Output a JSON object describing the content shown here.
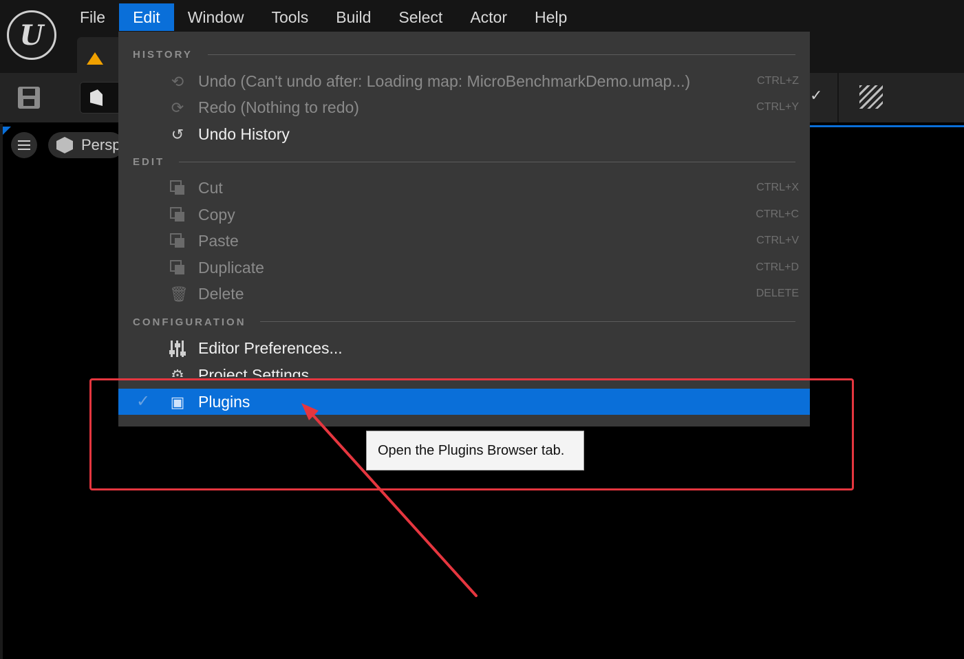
{
  "menubar": {
    "logo_letter": "U",
    "items": [
      {
        "label": "File"
      },
      {
        "label": "Edit",
        "active": true
      },
      {
        "label": "Window"
      },
      {
        "label": "Tools"
      },
      {
        "label": "Build"
      },
      {
        "label": "Select"
      },
      {
        "label": "Actor"
      },
      {
        "label": "Help"
      }
    ]
  },
  "viewport": {
    "perspective_label": "Persp"
  },
  "edit_menu": {
    "sections": {
      "history": "HISTORY",
      "edit": "EDIT",
      "configuration": "CONFIGURATION"
    },
    "items": {
      "undo": {
        "label": "Undo (Can't undo after: Loading map: MicroBenchmarkDemo.umap...)",
        "shortcut": "CTRL+Z",
        "icon": "undo-icon"
      },
      "redo": {
        "label": "Redo (Nothing to redo)",
        "shortcut": "CTRL+Y",
        "icon": "redo-icon"
      },
      "undo_history": {
        "label": "Undo History",
        "icon": "history-icon"
      },
      "cut": {
        "label": "Cut",
        "shortcut": "CTRL+X",
        "icon": "cut-icon"
      },
      "copy": {
        "label": "Copy",
        "shortcut": "CTRL+C",
        "icon": "copy-icon"
      },
      "paste": {
        "label": "Paste",
        "shortcut": "CTRL+V",
        "icon": "paste-icon"
      },
      "duplicate": {
        "label": "Duplicate",
        "shortcut": "CTRL+D",
        "icon": "duplicate-icon"
      },
      "delete": {
        "label": "Delete",
        "shortcut": "DELETE",
        "icon": "trash-icon"
      },
      "editor_preferences": {
        "label": "Editor Preferences...",
        "icon": "sliders-icon"
      },
      "project_settings": {
        "label": "Project Settings",
        "icon": "gear-icon"
      },
      "plugins": {
        "label": "Plugins",
        "icon": "plugin-icon",
        "highlighted": true
      }
    }
  },
  "tooltip": {
    "text": "Open the Plugins Browser tab."
  },
  "colors": {
    "accent": "#0a6fd9",
    "annotation": "#e5363f",
    "menu_bg": "#383838"
  }
}
